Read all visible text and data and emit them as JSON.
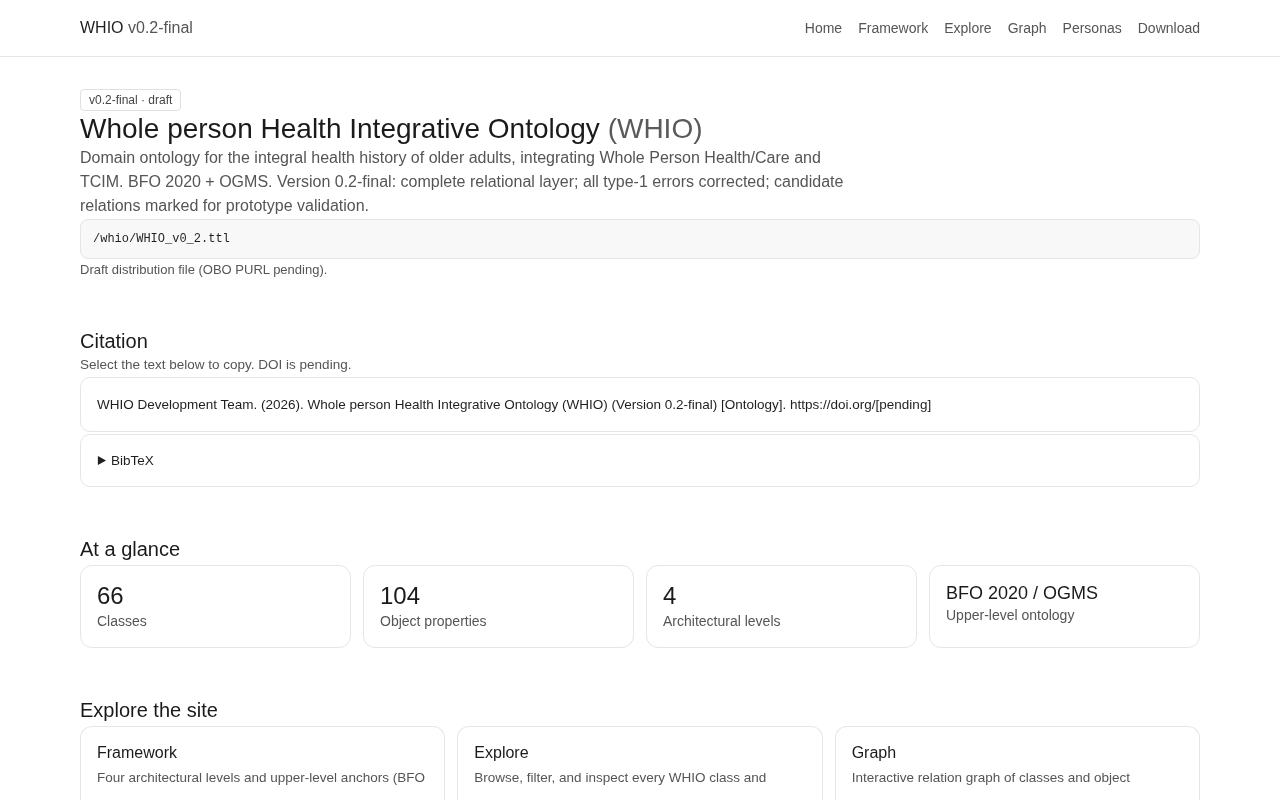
{
  "header": {
    "brand": "WHIO",
    "version": "v0.2-final",
    "nav": [
      {
        "label": "Home"
      },
      {
        "label": "Framework"
      },
      {
        "label": "Explore"
      },
      {
        "label": "Graph"
      },
      {
        "label": "Personas"
      },
      {
        "label": "Download"
      }
    ]
  },
  "hero": {
    "badge": "v0.2-final · draft",
    "title": "Whole person Health Integrative Ontology",
    "title_abbr": "(WHIO)",
    "description": "Domain ontology for the integral health history of older adults, integrating Whole Person Health/Care and TCIM. BFO 2020 + OGMS. Version 0.2-final: complete relational layer; all type-1 errors corrected; candidate relations marked for prototype validation.",
    "file_path": "/whio/WHIO_v0_2.ttl",
    "file_note": "Draft distribution file (OBO PURL pending)."
  },
  "citation": {
    "heading": "Citation",
    "note": "Select the text below to copy. DOI is pending.",
    "text": "WHIO Development Team. (2026). Whole person Health Integrative Ontology (WHIO) (Version 0.2-final) [Ontology]. https://doi.org/[pending]",
    "bibtex": {
      "label": "BibTeX",
      "expanded": false
    }
  },
  "glance": {
    "heading": "At a glance",
    "stats": [
      {
        "kind": "number",
        "value": "66",
        "label": "Classes"
      },
      {
        "kind": "number",
        "value": "104",
        "label": "Object properties"
      },
      {
        "kind": "number",
        "value": "4",
        "label": "Architectural levels"
      },
      {
        "kind": "text",
        "value": "BFO 2020 / OGMS",
        "label": "Upper-level ontology"
      }
    ]
  },
  "explore": {
    "heading": "Explore the site",
    "cards": [
      {
        "title": "Framework",
        "description": "Four architectural levels and upper-level anchors (BFO"
      },
      {
        "title": "Explore",
        "description": "Browse, filter, and inspect every WHIO class and"
      },
      {
        "title": "Graph",
        "description": "Interactive relation graph of classes and object"
      }
    ]
  }
}
